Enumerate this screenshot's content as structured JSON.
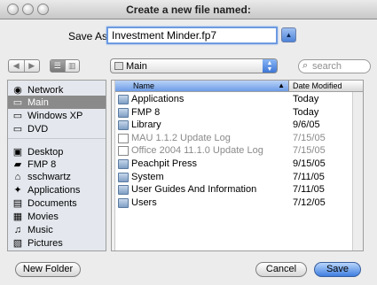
{
  "window": {
    "title": "Create a new file named:"
  },
  "save_as": {
    "label": "Save As:",
    "value": "Investment Minder.fp7"
  },
  "toolbar": {
    "back_glyph": "◀",
    "forward_glyph": "▶",
    "location": "Main",
    "search_placeholder": "search"
  },
  "sidebar": {
    "items": [
      {
        "label": "Network",
        "icon": "network-icon",
        "glyph": "◉"
      },
      {
        "label": "Main",
        "icon": "hard-drive-icon",
        "glyph": "▭",
        "selected": true
      },
      {
        "label": "Windows XP",
        "icon": "hard-drive-icon",
        "glyph": "▭"
      },
      {
        "label": "DVD",
        "icon": "dvd-icon",
        "glyph": "▭"
      },
      {
        "label": "Desktop",
        "icon": "desktop-icon",
        "glyph": "▣"
      },
      {
        "label": "FMP 8",
        "icon": "folder-icon",
        "glyph": "▰"
      },
      {
        "label": "sschwartz",
        "icon": "home-icon",
        "glyph": "⌂"
      },
      {
        "label": "Applications",
        "icon": "applications-icon",
        "glyph": "✦"
      },
      {
        "label": "Documents",
        "icon": "documents-icon",
        "glyph": "▤"
      },
      {
        "label": "Movies",
        "icon": "movies-icon",
        "glyph": "▦"
      },
      {
        "label": "Music",
        "icon": "music-icon",
        "glyph": "♫"
      },
      {
        "label": "Pictures",
        "icon": "pictures-icon",
        "glyph": "▧"
      }
    ]
  },
  "browser": {
    "columns": {
      "name": "Name",
      "date": "Date Modified",
      "sort_glyph": "▲"
    },
    "files": [
      {
        "name": "Applications",
        "date": "Today",
        "kind": "folder",
        "dim": false
      },
      {
        "name": "FMP 8",
        "date": "Today",
        "kind": "folder",
        "dim": false
      },
      {
        "name": "Library",
        "date": "9/6/05",
        "kind": "folder",
        "dim": false
      },
      {
        "name": "MAU 1.1.2 Update Log",
        "date": "7/15/05",
        "kind": "doc",
        "dim": true
      },
      {
        "name": "Office 2004 11.1.0 Update Log",
        "date": "7/15/05",
        "kind": "doc",
        "dim": true
      },
      {
        "name": "Peachpit Press",
        "date": "9/15/05",
        "kind": "folder",
        "dim": false
      },
      {
        "name": "System",
        "date": "7/11/05",
        "kind": "folder",
        "dim": false
      },
      {
        "name": "User Guides And Information",
        "date": "7/11/05",
        "kind": "folder",
        "dim": false
      },
      {
        "name": "Users",
        "date": "7/12/05",
        "kind": "folder",
        "dim": false
      }
    ]
  },
  "buttons": {
    "new_folder": "New Folder",
    "cancel": "Cancel",
    "save": "Save"
  }
}
